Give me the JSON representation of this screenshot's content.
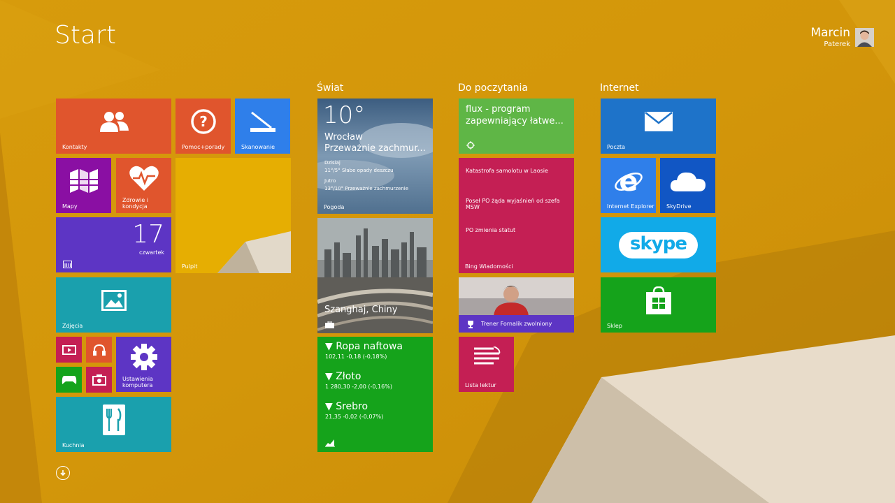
{
  "screen": {
    "title": "Start"
  },
  "user": {
    "first_name": "Marcin",
    "last_name": "Paterek"
  },
  "groups": {
    "swiat": "Świat",
    "do_poczytania": "Do poczytania",
    "internet": "Internet"
  },
  "tiles": {
    "kontakty": "Kontakty",
    "pomoc": "Pomoc+porady",
    "skanowanie": "Skanowanie",
    "mapy": "Mapy",
    "zdrowie": "Zdrowie i\nkondycja",
    "pulpit": "Pulpit",
    "kalendarz": {
      "day": "17",
      "weekday": "czwartek"
    },
    "zdjecia": "Zdjęcia",
    "ustawienia": "Ustawienia\nkomputera",
    "kuchnia": "Kuchnia",
    "pogoda": {
      "temp": "10°",
      "city": "Wrocław",
      "condition": "Przeważnie zachmur...",
      "today_label": "Dzisiaj",
      "today": "11°/5° Słabe opady deszczu",
      "tomorrow_label": "Jutro",
      "tomorrow": "13°/10° Przeważnie zachmurzenie",
      "label": "Pogoda"
    },
    "podroze": {
      "place": "Szanghaj, Chiny"
    },
    "finanse": {
      "items": [
        {
          "name": "▼ Ropa naftowa",
          "value": "102,11 -0,18 (-0,18%)"
        },
        {
          "name": "▼ Złoto",
          "value": "1 280,30 -2,00 (-0,16%)"
        },
        {
          "name": "▼ Srebro",
          "value": "21,35 -0,02 (-0,07%)"
        }
      ]
    },
    "flux": "flux - program zapewniający łatwe...",
    "wiadomosci": {
      "headlines": [
        "Katastrofa samolotu w Laosie",
        "Poseł PO żąda wyjaśnień od szefa MSW",
        "PO zmienia statut"
      ],
      "label": "Bing Wiadomości"
    },
    "sport": "Trener Fornalik zwolniony",
    "lista": "Lista lektur",
    "poczta": "Poczta",
    "ie": "Internet Explorer",
    "skydrive": "SkyDrive",
    "skype": "skype",
    "sklep": "Sklep"
  },
  "colors": {
    "background": "#d49c0c",
    "orange_red": "#e0552d",
    "blue": "#2f7fea",
    "purple": "#8a0fa3",
    "violet": "#5d35c4",
    "teal": "#1aa0ad",
    "green": "#15a31b",
    "light_green": "#5fb646",
    "crimson": "#c41f54",
    "mail_blue": "#1e73c9",
    "skydrive_blue": "#1156c4",
    "skype_blue": "#11aae8",
    "yellow_tile": "#e8b200"
  }
}
